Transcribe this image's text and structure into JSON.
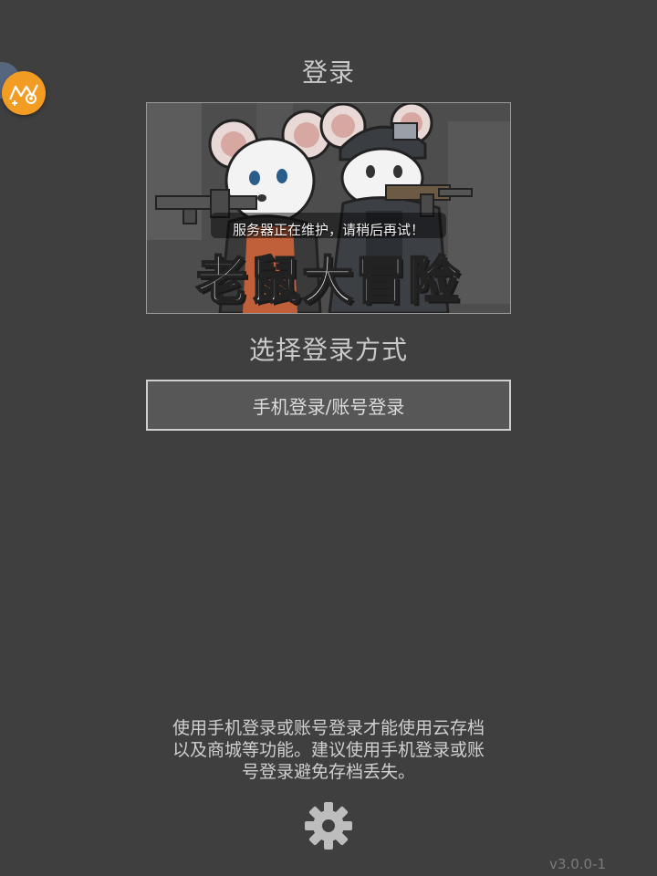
{
  "header": {
    "title": "登录"
  },
  "banner": {
    "notice": "服务器正在维护，请稍后再试！",
    "logo_text": "老鼠大冒险"
  },
  "login": {
    "subtitle": "选择登录方式",
    "button_label": "手机登录/账号登录"
  },
  "footer": {
    "info_text": "使用手机登录或账号登录才能使用云存档\n以及商城等功能。建议使用手机登录或账\n号登录避免存档丢失。",
    "settings_icon": "gear-icon",
    "version": "v3.0.0-1"
  },
  "floating_button": {
    "icon": "assistant-icon"
  },
  "colors": {
    "background": "#3f3f3f",
    "accent_orange": "#f39c24",
    "button_bg": "#575757",
    "text": "#cfcfcf"
  }
}
